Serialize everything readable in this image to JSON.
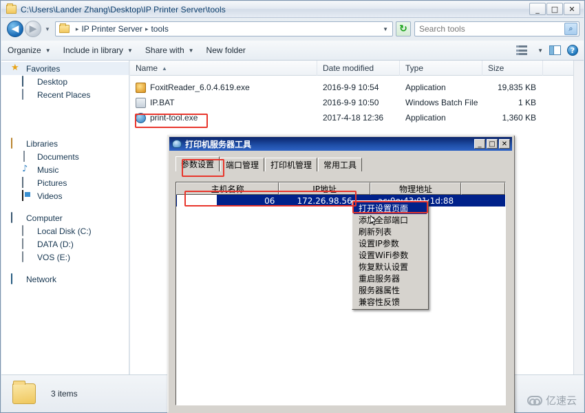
{
  "explorer": {
    "title": "C:\\Users\\Lander Zhang\\Desktop\\IP Printer Server\\tools",
    "window_controls": {
      "minimize": "_",
      "maximize": "□",
      "close": "✕"
    },
    "address": {
      "crumbs": [
        "IP Printer Server",
        "tools"
      ],
      "dropdown_caret": "▼",
      "refresh_label": "↻"
    },
    "search": {
      "placeholder": "Search tools",
      "value": "",
      "icon_label": "🔍"
    },
    "commands": [
      {
        "label": "Organize",
        "has_caret": true
      },
      {
        "label": "Include in library",
        "has_caret": true
      },
      {
        "label": "Share with",
        "has_caret": true
      },
      {
        "label": "New folder",
        "has_caret": false
      }
    ],
    "toolbar_right": {
      "view_caret": "▼",
      "view_icon": "list-view-icon",
      "preview_icon": "preview-pane-icon",
      "help_icon": "?"
    },
    "navigation": [
      {
        "label": "Favorites",
        "icon": "star-icon",
        "level": "root",
        "selected": true
      },
      {
        "label": "Desktop",
        "icon": "monitor-icon",
        "level": "child",
        "selected": false
      },
      {
        "label": "Recent Places",
        "icon": "recent-places-icon",
        "level": "child",
        "selected": false
      },
      {
        "label": "Libraries",
        "icon": "libraries-icon",
        "level": "root",
        "selected": false
      },
      {
        "label": "Documents",
        "icon": "document-icon",
        "level": "child",
        "selected": false
      },
      {
        "label": "Music",
        "icon": "music-icon",
        "level": "child",
        "selected": false
      },
      {
        "label": "Pictures",
        "icon": "picture-icon",
        "level": "child",
        "selected": false
      },
      {
        "label": "Videos",
        "icon": "video-icon",
        "level": "child",
        "selected": false
      },
      {
        "label": "Computer",
        "icon": "computer-icon",
        "level": "root",
        "selected": false
      },
      {
        "label": "Local Disk (C:)",
        "icon": "hard-disk-icon",
        "level": "child",
        "selected": false
      },
      {
        "label": "DATA (D:)",
        "icon": "drive-icon",
        "level": "child",
        "selected": false
      },
      {
        "label": "VOS (E:)",
        "icon": "drive-icon",
        "level": "child",
        "selected": false
      },
      {
        "label": "Network",
        "icon": "network-icon",
        "level": "root",
        "selected": false
      }
    ],
    "columns": [
      {
        "label": "Name",
        "sort": "▲"
      },
      {
        "label": "Date modified",
        "sort": ""
      },
      {
        "label": "Type",
        "sort": ""
      },
      {
        "label": "Size",
        "sort": ""
      }
    ],
    "files": [
      {
        "name": "FoxitReader_6.0.4.619.exe",
        "date": "2016-9-9 10:54",
        "type": "Application",
        "size": "19,835 KB",
        "icon": "foxit-reader-icon",
        "highlighted": false
      },
      {
        "name": "IP.BAT",
        "date": "2016-9-9 10:50",
        "type": "Windows Batch File",
        "size": "1 KB",
        "icon": "batch-file-icon",
        "highlighted": false
      },
      {
        "name": "print-tool.exe",
        "date": "2017-4-18 12:36",
        "type": "Application",
        "size": "1,360 KB",
        "icon": "print-tool-icon",
        "highlighted": true
      }
    ],
    "status": {
      "items_text": "3 items",
      "folder_icon": "folder-icon"
    }
  },
  "dialog": {
    "title": "打印机服务器工具",
    "window_controls": {
      "minimize": "_",
      "maximize": "□",
      "close": "✕"
    },
    "tabs": [
      {
        "label": "参数设置",
        "active": true
      },
      {
        "label": "端口管理",
        "active": false
      },
      {
        "label": "打印机管理",
        "active": false
      },
      {
        "label": "常用工具",
        "active": false
      }
    ],
    "table": {
      "columns": [
        "主机名称",
        "IP地址",
        "物理地址",
        ""
      ],
      "rows": [
        {
          "hostname": "06",
          "ip": "172.26.98.56",
          "mac": "ac:0e:43:91:1d:88",
          "extra": "",
          "selected": true
        }
      ]
    },
    "context_menu": [
      {
        "label": "打开设置页面",
        "selected": true
      },
      {
        "label": "添加全部端口",
        "selected": false
      },
      {
        "label": "刷新列表",
        "selected": false
      },
      {
        "label": "设置IP参数",
        "selected": false
      },
      {
        "label": "设置WiFi参数",
        "selected": false
      },
      {
        "label": "恢复默认设置",
        "selected": false
      },
      {
        "label": "重启服务器",
        "selected": false
      },
      {
        "label": "服务器属性",
        "selected": false
      },
      {
        "label": "兼容性反馈",
        "selected": false
      }
    ]
  },
  "watermark": {
    "text": "亿速云",
    "icon": "cloud-icon"
  },
  "colors": {
    "annotation_red": "#e8352b",
    "selection_blue": "#00218a",
    "titlebar_blue": "#0a246a",
    "dialog_face": "#d6d3ce"
  }
}
